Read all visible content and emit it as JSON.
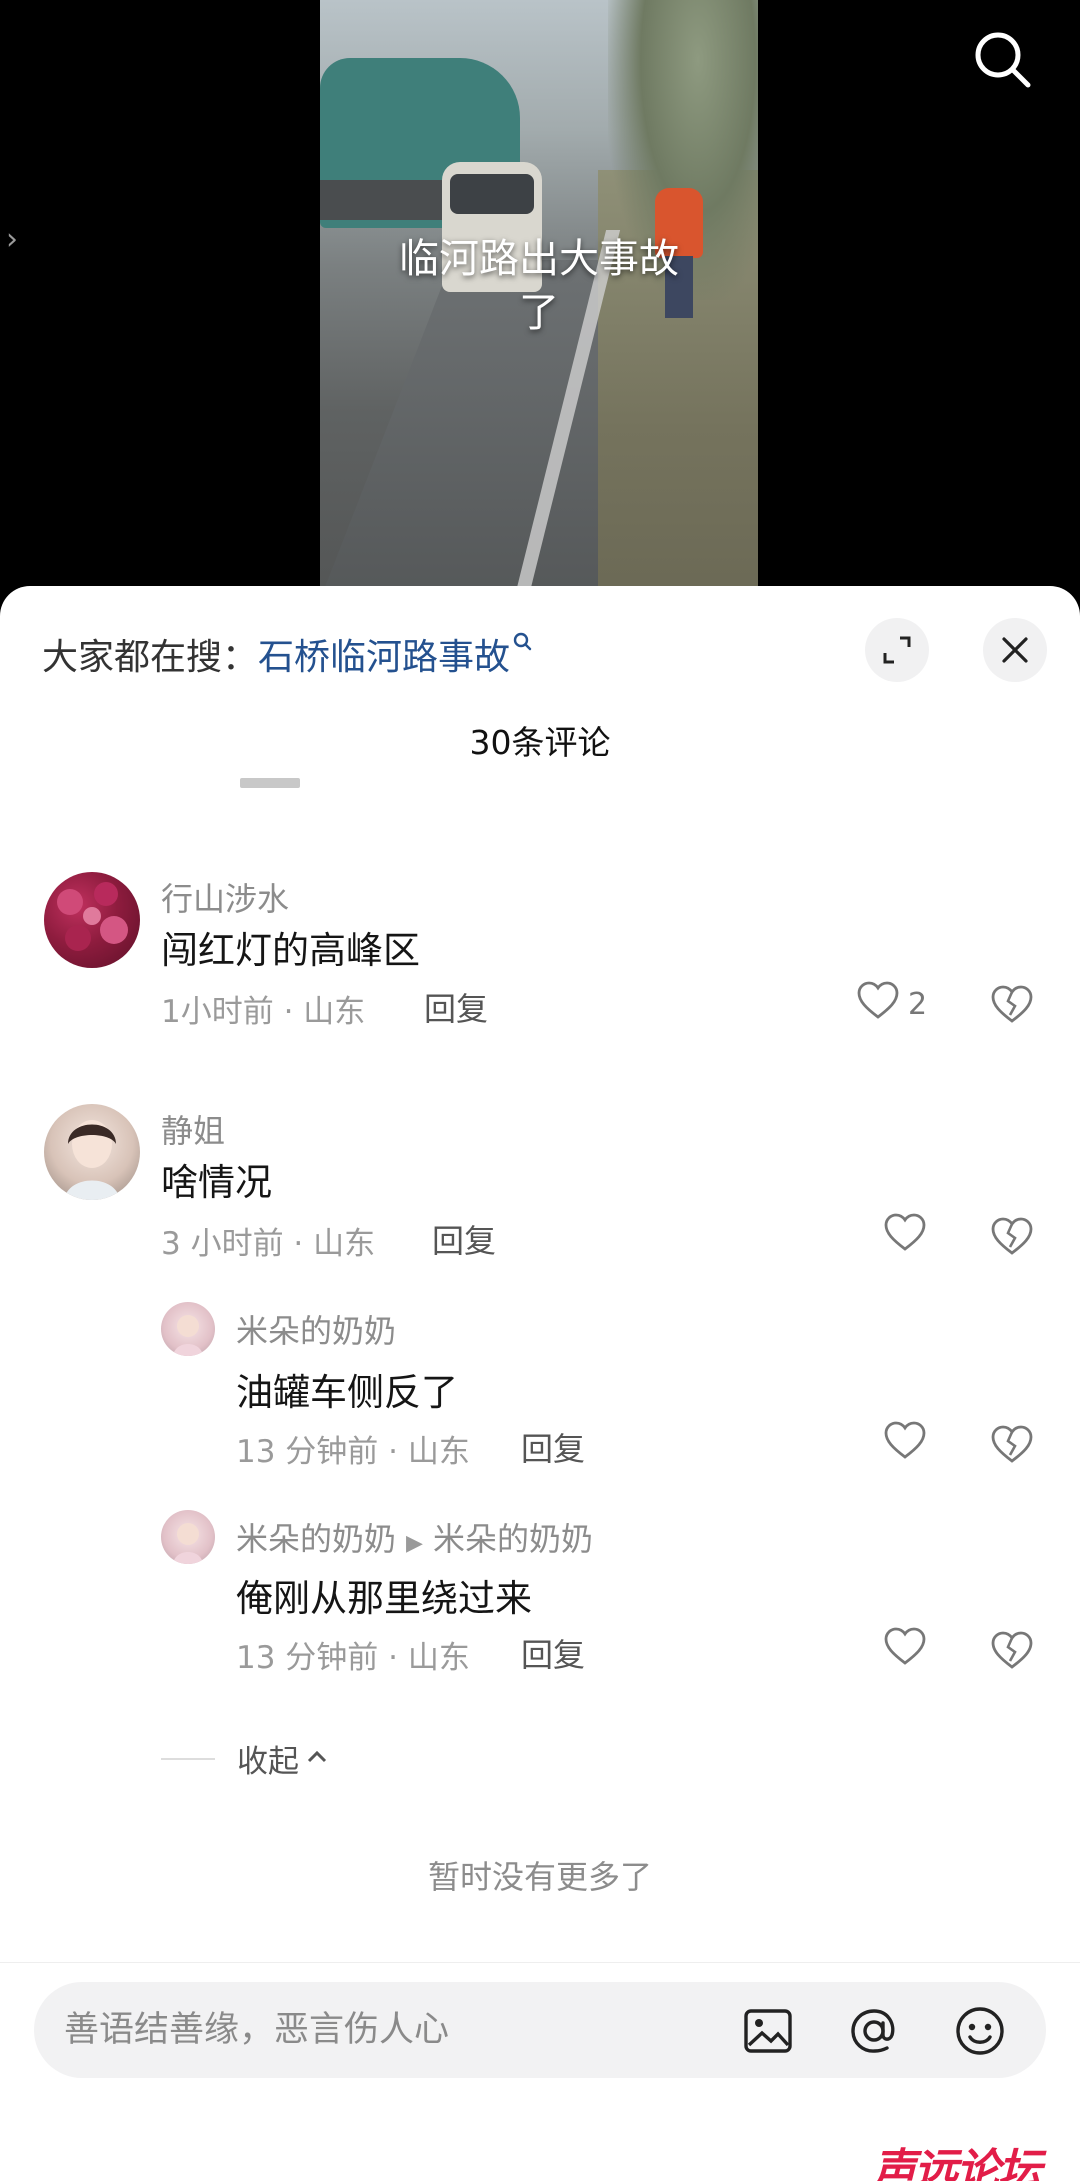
{
  "video": {
    "caption": "临河路出大事故了"
  },
  "panel": {
    "trending_prefix": "大家都在搜：",
    "trending_keyword": "石桥临河路事故",
    "comment_count": "30条评论"
  },
  "comments": [
    {
      "username": "行山涉水",
      "text": "闯红灯的高峰区",
      "meta": "1小时前 · 山东",
      "reply_label": "回复",
      "likes": "2"
    },
    {
      "username": "静姐",
      "text": "啥情况",
      "meta": "3 小时前 · 山东",
      "reply_label": "回复",
      "likes": ""
    }
  ],
  "replies": [
    {
      "username": "米朵的奶奶",
      "text": "油罐车侧反了",
      "meta": "13 分钟前 · 山东",
      "reply_label": "回复"
    },
    {
      "username": "米朵的奶奶",
      "reply_to": "米朵的奶奶",
      "text": "俺刚从那里绕过来",
      "meta": "13 分钟前 · 山东",
      "reply_label": "回复"
    }
  ],
  "collapse_label": "收起",
  "no_more_text": "暂时没有更多了",
  "input": {
    "placeholder": "善语结善缘，恶言伤人心"
  },
  "watermark": "声远论坛",
  "colors": {
    "keyword": "#24518f",
    "watermark": "#e21d48"
  }
}
